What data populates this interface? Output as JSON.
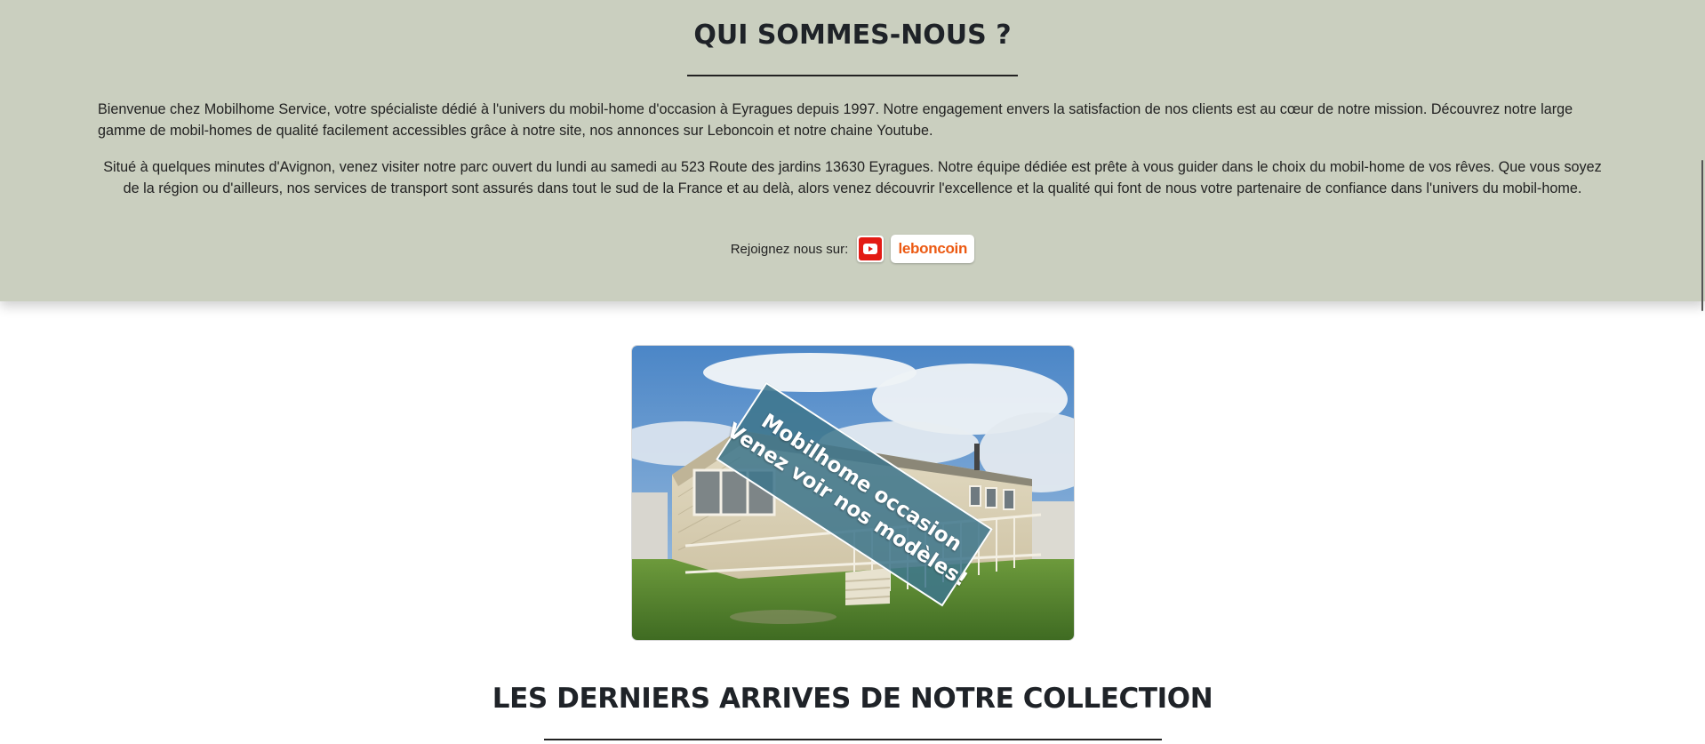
{
  "about": {
    "title": "QUI SOMMES-NOUS ?",
    "paragraph1": "Bienvenue chez Mobilhome Service, votre spécialiste dédié à l'univers du mobil-home d'occasion à Eyragues depuis 1997. Notre engagement envers la satisfaction de nos clients est au cœur de notre mission. Découvrez notre large gamme de mobil-homes de qualité facilement accessibles grâce à notre site, nos annonces sur Leboncoin et notre chaine Youtube.",
    "paragraph2": "Situé à quelques minutes d'Avignon, venez visiter notre parc ouvert du lundi au samedi au 523 Route des jardins 13630 Eyragues. Notre équipe dédiée est prête à vous guider dans le choix du mobil-home de vos rêves. Que vous soyez de la région ou d'ailleurs, nos services de transport sont assurés dans tout le sud de la France et au delà, alors venez découvrir l'excellence et la qualité qui font de nous votre partenaire de confiance dans l'univers du mobil-home.",
    "join_label": "Rejoignez nous sur:",
    "social": [
      {
        "icon": "youtube-icon",
        "color": "#e31b14"
      },
      {
        "label": "leboncoin",
        "color": "#ec5a13"
      }
    ]
  },
  "hero": {
    "banner_line1": "Mobilhome occasion",
    "banner_line2": "Venez voir nos modèles!"
  },
  "collection": {
    "title": "LES DERNIERS ARRIVES DE NOTRE COLLECTION"
  },
  "colors": {
    "about_background": "#cacfbf",
    "banner": "#3e768c"
  }
}
